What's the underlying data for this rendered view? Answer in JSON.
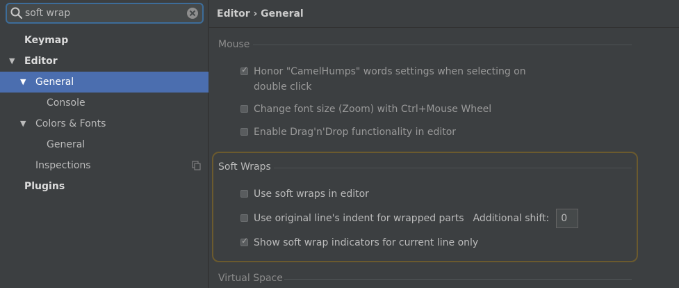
{
  "search": {
    "value": "soft wrap",
    "icon": "search-icon",
    "clear_icon": "clear-icon"
  },
  "sidebar": {
    "items": [
      {
        "label": "Keymap",
        "bold": true,
        "level": 0
      },
      {
        "label": "Editor",
        "bold": true,
        "level": 0,
        "expanded": true
      },
      {
        "label": "General",
        "bold": false,
        "level": 1,
        "expanded": true,
        "selected": true
      },
      {
        "label": "Console",
        "bold": false,
        "level": 2
      },
      {
        "label": "Colors & Fonts",
        "bold": false,
        "level": 1,
        "expanded": true
      },
      {
        "label": "General",
        "bold": false,
        "level": 2
      },
      {
        "label": "Inspections",
        "bold": false,
        "level": 1,
        "copy_icon": "copy-icon"
      },
      {
        "label": "Plugins",
        "bold": true,
        "level": 0
      }
    ]
  },
  "breadcrumb": {
    "path": "Editor › General"
  },
  "sections": {
    "mouse": {
      "title": "Mouse",
      "options": [
        {
          "label_line1": "Honor \"CamelHumps\" words settings when selecting on",
          "label_line2": "double click",
          "checked": true
        },
        {
          "label": "Change font size (Zoom) with Ctrl+Mouse Wheel",
          "checked": false
        },
        {
          "label": "Enable Drag'n'Drop functionality in editor",
          "checked": false
        }
      ]
    },
    "soft_wraps": {
      "title": "Soft Wraps",
      "options": [
        {
          "label": "Use soft wraps in editor",
          "checked": false
        },
        {
          "label": "Use original line's indent for wrapped parts",
          "checked": false
        },
        {
          "label": "Show soft wrap indicators for current line only",
          "checked": true
        }
      ],
      "additional_shift_label": "Additional shift:",
      "additional_shift_value": "0"
    },
    "virtual_space": {
      "title": "Virtual Space"
    }
  },
  "colors": {
    "selection": "#4b6eaf",
    "highlight_border": "#6b5a2e",
    "focus_border": "#3d6d9a",
    "background": "#3c3f41"
  }
}
